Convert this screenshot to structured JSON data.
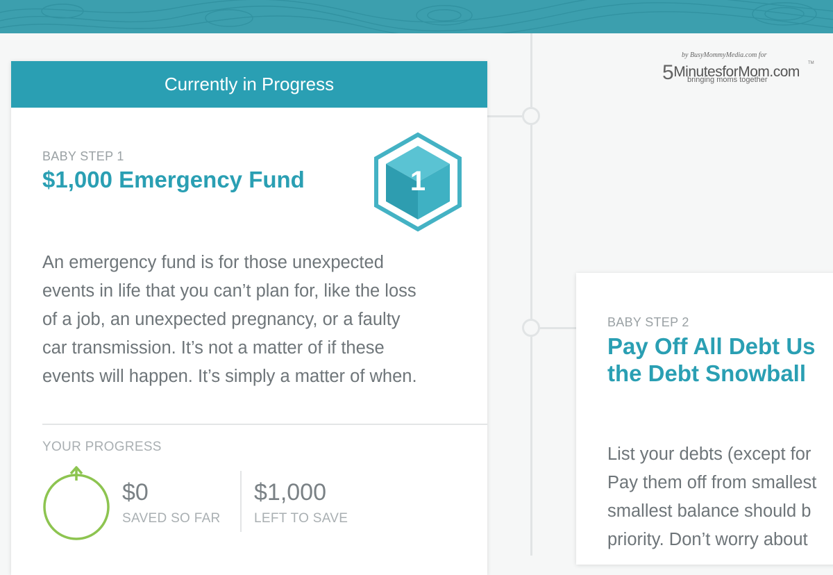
{
  "branding": {
    "watermark_by": "by BusyMommyMedia.com for",
    "watermark_five": "5",
    "watermark_logo": "MinutesforMom.com",
    "watermark_tm": "TM",
    "watermark_tagline": "bringing moms together"
  },
  "colors": {
    "accent": "#2a9fb3",
    "banner": "#3c9fae",
    "progress_green": "#8dc450",
    "text_gray": "#6e7579"
  },
  "card1": {
    "header": "Currently in Progress",
    "step_label": "BABY STEP 1",
    "title": "$1,000 Emergency Fund",
    "badge_icon": "hexagon-cube-badge",
    "badge_number": "1",
    "description_lines": [
      "An emergency fund is for those unexpected",
      "events in life that you can’t plan for, like the loss",
      "of a job, an unexpected pregnancy, or a faulty",
      "car transmission. It’s not a matter of if these",
      "events will happen. It’s simply a matter of when."
    ],
    "progress": {
      "label": "YOUR PROGRESS",
      "icon": "progress-ring-arrow-icon",
      "fraction": 0,
      "saved_value": "$0",
      "saved_label": "SAVED SO FAR",
      "left_value": "$1,000",
      "left_label": "LEFT TO SAVE"
    }
  },
  "card2": {
    "step_label": "BABY STEP 2",
    "title_line1": "Pay Off All Debt Us",
    "title_line2": "the Debt Snowball",
    "description_lines": [
      "List your debts (except for",
      "Pay them off from smallest",
      "smallest balance should b",
      "priority. Don’t worry about"
    ]
  }
}
